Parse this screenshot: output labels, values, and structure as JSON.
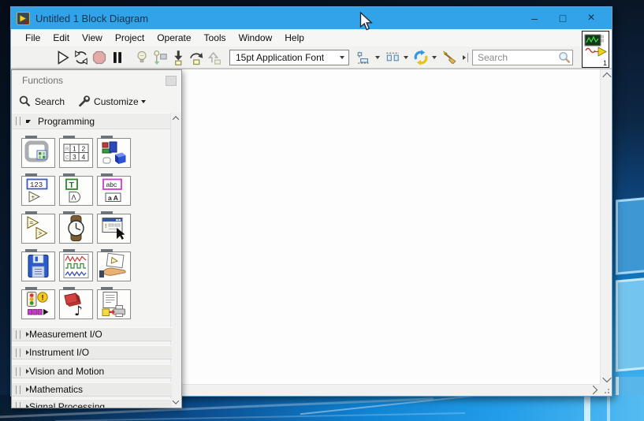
{
  "colors": {
    "titlebar": "#32a3e8",
    "desktop_dark": "#0a1a2e",
    "desktop_accent": "#0f85d6",
    "window_bg": "#f0f0f0",
    "canvas_bg": "#fdfdfd"
  },
  "window": {
    "title": "Untitled 1 Block Diagram",
    "app_icon": "labview-block-diagram-icon",
    "controls": {
      "minimize": "–",
      "maximize": "□",
      "close": "×"
    }
  },
  "menu": {
    "items": [
      "File",
      "Edit",
      "View",
      "Project",
      "Operate",
      "Tools",
      "Window",
      "Help"
    ]
  },
  "toolbar": {
    "font_selector": "15pt Application Font",
    "search_placeholder": "Search",
    "help_glyph": "?",
    "icons": [
      "run",
      "run-continuously",
      "abort-execution",
      "pause",
      "highlight-execution",
      "retain-wire-values",
      "step-into",
      "step-over",
      "step-out",
      "align-objects",
      "distribute-objects",
      "reorder-objects",
      "clean-up-diagram",
      "search",
      "context-help"
    ]
  },
  "vi_icon": {
    "badge": "1"
  },
  "palette": {
    "title": "Functions",
    "search_label": "Search",
    "customize_label": "Customize",
    "sections": [
      {
        "label": "Programming",
        "expanded": true,
        "items": [
          "Structures",
          "Array",
          "Cluster, Class & Variant",
          "Numeric",
          "Boolean",
          "String",
          "Comparison",
          "Timing",
          "Dialog & User Interface",
          "File I/O",
          "Waveform",
          "Application Control",
          "Synchronization",
          "Graphics & Sound",
          "Report Generation"
        ]
      },
      {
        "label": "Measurement I/O",
        "expanded": false
      },
      {
        "label": "Instrument I/O",
        "expanded": false
      },
      {
        "label": "Vision and Motion",
        "expanded": false
      },
      {
        "label": "Mathematics",
        "expanded": false
      },
      {
        "label": "Signal Processing",
        "expanded": false
      }
    ]
  }
}
